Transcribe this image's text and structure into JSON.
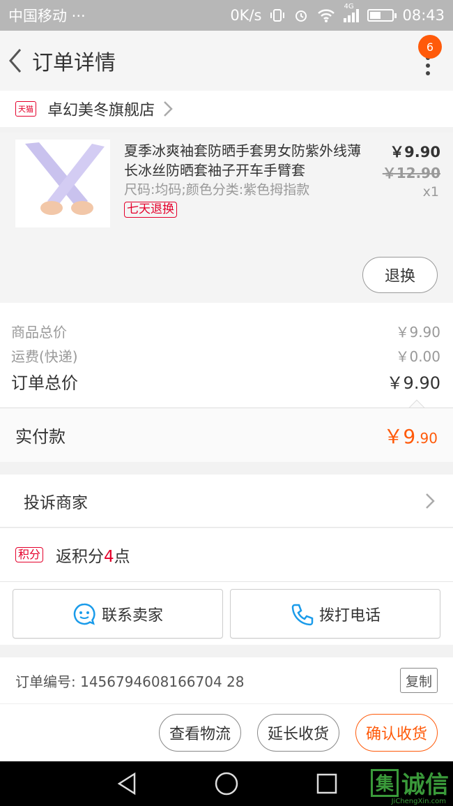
{
  "status_bar": {
    "carrier": "中国移动 ···",
    "speed": "0K/s",
    "network": "4G",
    "battery_level": 0.5,
    "time": "08:43"
  },
  "header": {
    "title": "订单详情",
    "menu_badge": "6",
    "icons": {
      "back": "chevron-left-icon",
      "more": "more-vertical-icon"
    }
  },
  "shop": {
    "badge": "天猫",
    "name": "卓幻美冬旗舰店"
  },
  "product": {
    "title": "夏季冰爽袖套防晒手套男女防紫外线薄长冰丝防晒套袖子开车手臂套",
    "sku": "尺码:均码;颜色分类:紫色拇指款",
    "tag": "七天退换",
    "price": "￥9.90",
    "original_price": "￥12.90",
    "quantity": "x1",
    "refund_button": "退换",
    "image_color": "#c9c2ee"
  },
  "summary": {
    "goods_total_label": "商品总价",
    "goods_total_value": "￥9.90",
    "shipping_label": "运费(快递)",
    "shipping_value": "￥0.00",
    "order_total_label": "订单总价",
    "order_total_value": "￥9.90"
  },
  "paid": {
    "label": "实付款",
    "currency_int": "￥9",
    "decimal": ".90"
  },
  "complain": {
    "label": "投诉商家"
  },
  "points": {
    "badge": "积分",
    "prefix": "返积分",
    "number": "4",
    "suffix": "点"
  },
  "contact": {
    "seller_label": "联系卖家",
    "phone_label": "拨打电话"
  },
  "order": {
    "number_label": "订单编号: 1456794608166704 28",
    "copy_label": "复制"
  },
  "actions": {
    "logistics": "查看物流",
    "extend": "延长收货",
    "confirm": "确认收货"
  },
  "watermark": {
    "text": "诚信",
    "box": "集",
    "sub": "JiChengXin.com"
  },
  "colors": {
    "accent": "#ff5a0a",
    "tmall_red": "#e4002b",
    "contact_blue": "#1a9bea"
  }
}
